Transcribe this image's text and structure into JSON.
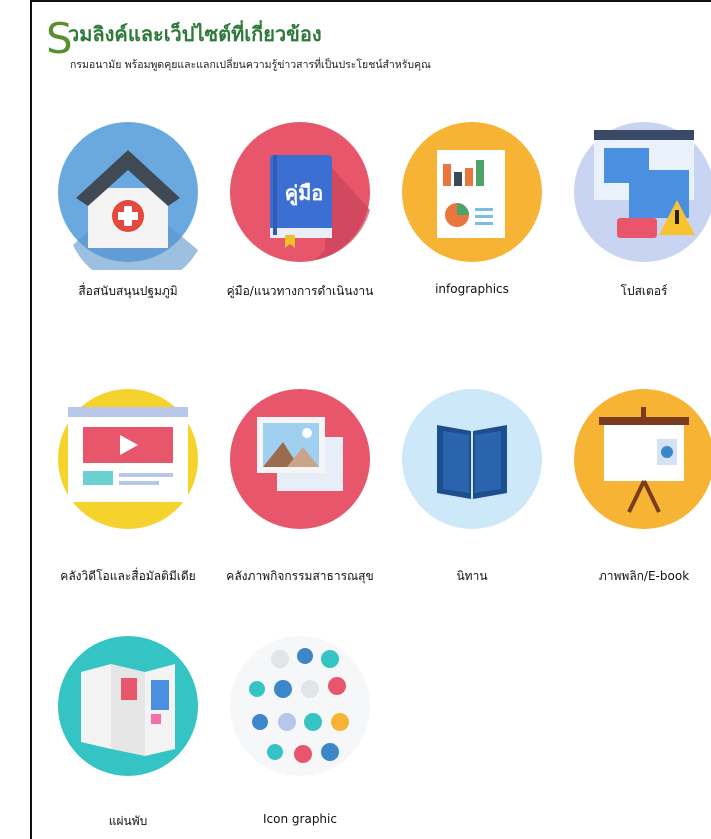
{
  "header": {
    "big_letter": "S",
    "title": "วมลิงค์และเว็ปไซต์ที่เกี่ยวข้อง",
    "subtitle": "กรมอนามัย พร้อมพูดคุยและแลกเปลี่ยนความรู้ข่าวสารที่เป็นประโยชน์สำหรับคุณ"
  },
  "colors": {
    "title": "#2e7a3a",
    "blue": "#6aa9e0",
    "pink": "#e8566c",
    "orange": "#f7b334",
    "lavender": "#c9d3f2",
    "yellow": "#f6d22c",
    "lightblue": "#cde8f8",
    "teal": "#35c4c4"
  },
  "items": [
    {
      "label": "สื่อสนับสนุนปฐมภูมิ",
      "icon": "house-medical-icon"
    },
    {
      "label": "คู่มือ/แนวทางการดำเนินงาน",
      "icon": "manual-book-icon",
      "book_text": "คู่มือ"
    },
    {
      "label": "infographics",
      "icon": "infographic-icon"
    },
    {
      "label": "โปสเตอร์",
      "icon": "poster-window-icon"
    },
    {
      "label": "คลังวิดีโอและสื่อมัลติมีเดีย",
      "icon": "video-player-icon"
    },
    {
      "label": "คลังภาพกิจกรรมสาธารณสุข",
      "icon": "photo-gallery-icon"
    },
    {
      "label": "นิทาน",
      "icon": "open-book-icon"
    },
    {
      "label": "ภาพพลิก/E-book",
      "icon": "presentation-board-icon"
    },
    {
      "label": "แผ่นพับ",
      "icon": "brochure-icon"
    },
    {
      "label": "Icon graphic",
      "icon": "dental-icons-icon"
    }
  ]
}
